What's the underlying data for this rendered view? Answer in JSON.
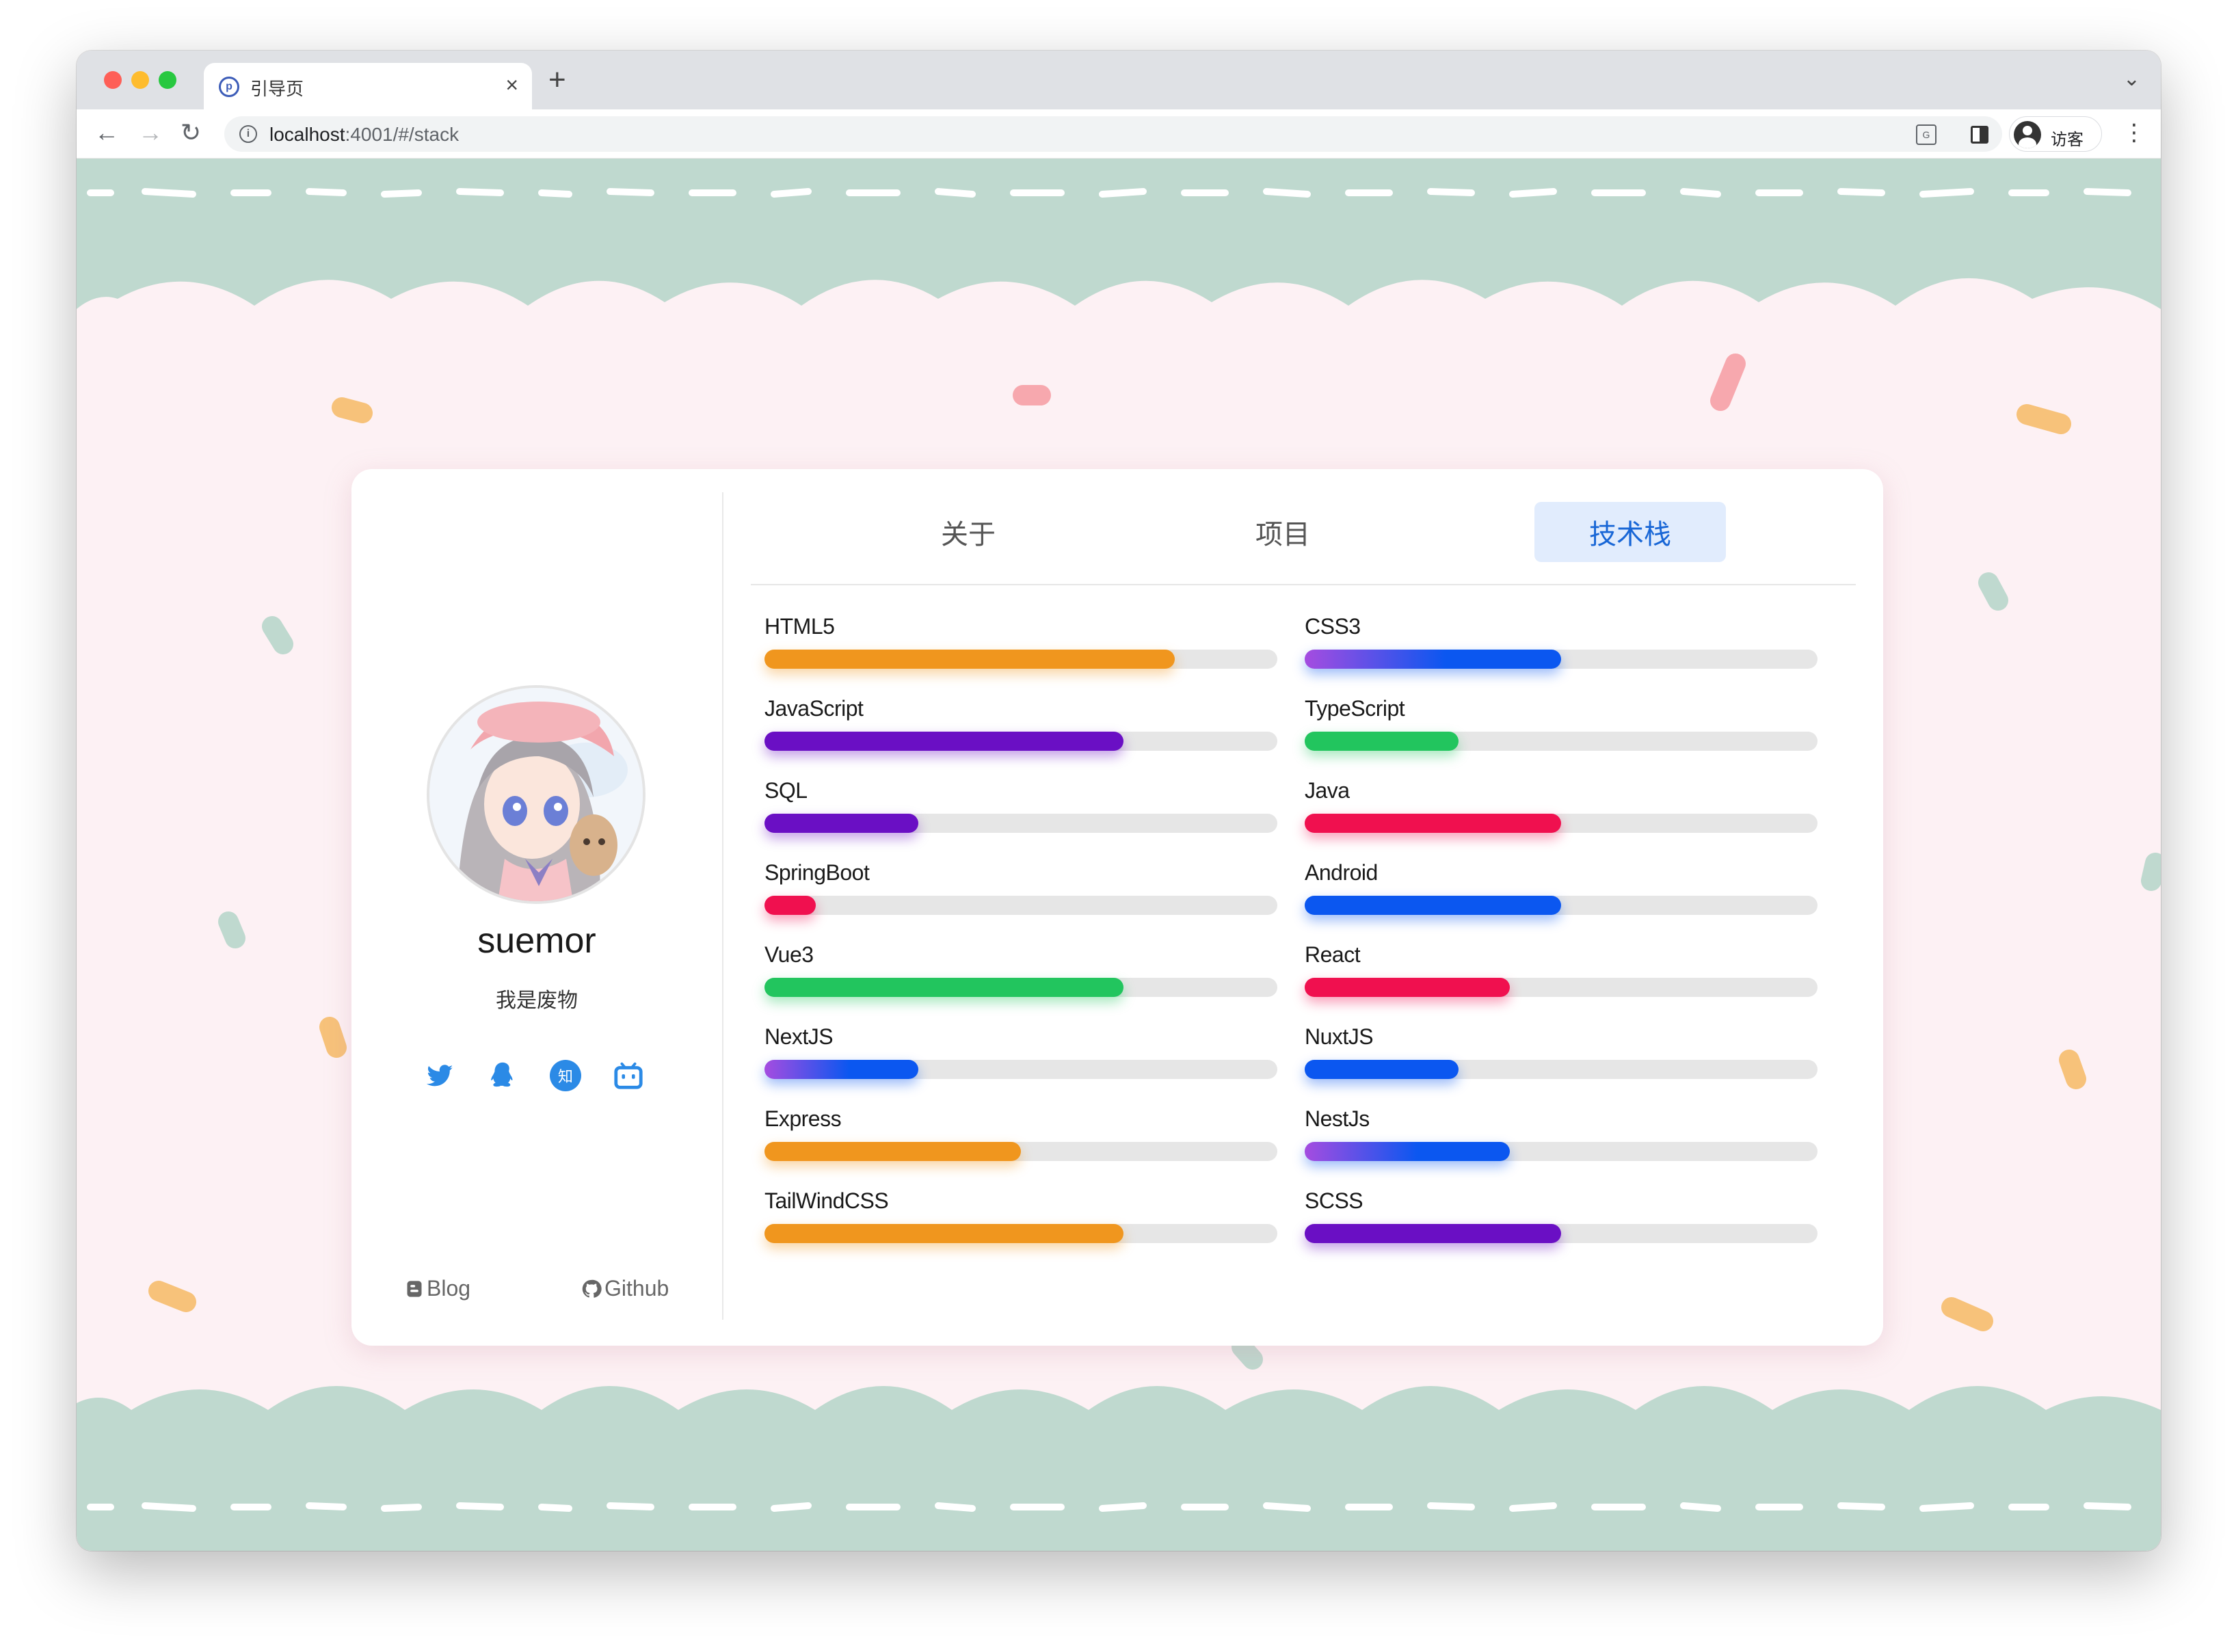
{
  "browser": {
    "tab_title": "引导页",
    "tab_close": "×",
    "new_tab": "+",
    "tab_menu": "⌄",
    "url_host": "localhost",
    "url_rest": ":4001/#/stack",
    "profile_name": "访客",
    "nav_back": "←",
    "nav_forward": "→",
    "nav_reload": "↻",
    "menu": "⋮"
  },
  "profile": {
    "username": "suemor",
    "bio": "我是废物",
    "socials": [
      "twitter-icon",
      "qq-icon",
      "zhihu-icon",
      "bilibili-icon"
    ],
    "zhihu_glyph": "知",
    "blog_label": "Blog",
    "github_label": "Github"
  },
  "tabs": [
    {
      "label": "关于",
      "active": false
    },
    {
      "label": "项目",
      "active": false
    },
    {
      "label": "技术栈",
      "active": true
    }
  ],
  "colors": {
    "orange": "#f0961e",
    "purple": "#6a0fc4",
    "green": "#22c55e",
    "red": "#f0104f",
    "blue": "#0b57f0",
    "grad_start": "#a54ce0",
    "track": "#e6e6e6",
    "accent": "#1866d6",
    "scallop": "#bfd9cf",
    "page_bg": "#fdf1f4"
  },
  "skills_left": [
    {
      "name": "HTML5",
      "level": 0.8,
      "color": "orange"
    },
    {
      "name": "JavaScript",
      "level": 0.7,
      "color": "purple"
    },
    {
      "name": "SQL",
      "level": 0.3,
      "color": "purple"
    },
    {
      "name": "SpringBoot",
      "level": 0.1,
      "color": "red"
    },
    {
      "name": "Vue3",
      "level": 0.7,
      "color": "green"
    },
    {
      "name": "NextJS",
      "level": 0.3,
      "color": "gradient"
    },
    {
      "name": "Express",
      "level": 0.5,
      "color": "orange"
    },
    {
      "name": "TailWindCSS",
      "level": 0.7,
      "color": "orange"
    }
  ],
  "skills_right": [
    {
      "name": "CSS3",
      "level": 0.5,
      "color": "gradient"
    },
    {
      "name": "TypeScript",
      "level": 0.3,
      "color": "green"
    },
    {
      "name": "Java",
      "level": 0.5,
      "color": "red"
    },
    {
      "name": "Android",
      "level": 0.5,
      "color": "blue"
    },
    {
      "name": "React",
      "level": 0.4,
      "color": "red"
    },
    {
      "name": "NuxtJS",
      "level": 0.3,
      "color": "blue"
    },
    {
      "name": "NestJs",
      "level": 0.4,
      "color": "gradient"
    },
    {
      "name": "SCSS",
      "level": 0.5,
      "color": "purple"
    }
  ]
}
